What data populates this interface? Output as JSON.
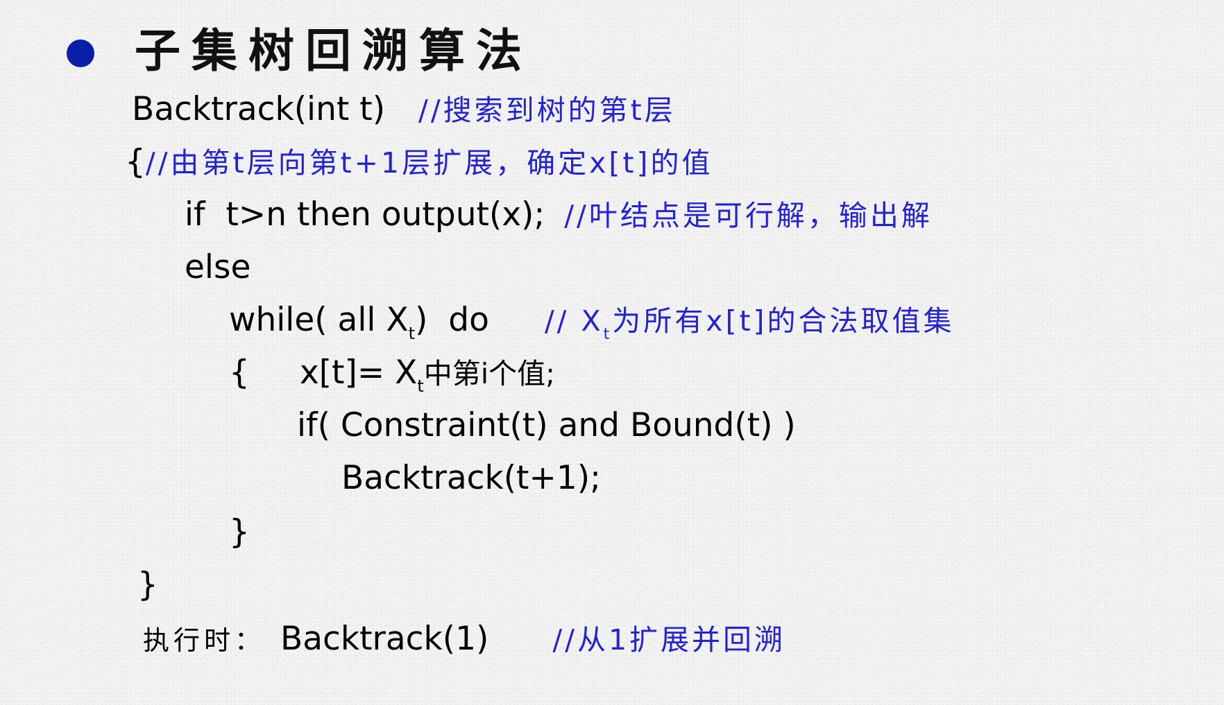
{
  "title": "子集树回溯算法",
  "lines": {
    "l1_code": "Backtrack(int t)",
    "l1_comment": "//搜索到树的第t层",
    "l2_brace": "{",
    "l2_comment": "//由第t层向第t+1层扩展，确定x[t]的值",
    "l3_code": "if  t>n then output(x);",
    "l3_comment": "//叶结点是可行解，输出解",
    "l4_code": "else",
    "l5_code_a": "while( all X",
    "l5_sub": "t",
    "l5_code_b": ")  do",
    "l5_comment_a": "// X",
    "l5_comment_sub": "t",
    "l5_comment_b": "为所有x[t]的合法取值集",
    "l6_brace": "{",
    "l6_code_a": "x[t]= X",
    "l6_sub": "t",
    "l6_code_b": "中第i个值;",
    "l7_code": "if( Constraint(t) and Bound(t) )",
    "l8_code": "Backtrack(t+1);",
    "l9_brace": "}",
    "l10_brace": "}",
    "l11_label": "执行时：",
    "l11_code": "Backtrack(1)",
    "l11_comment": "//从1扩展并回溯"
  },
  "colors": {
    "bullet": "#0a1fa8",
    "comment": "#2323d0",
    "text": "#000000"
  }
}
